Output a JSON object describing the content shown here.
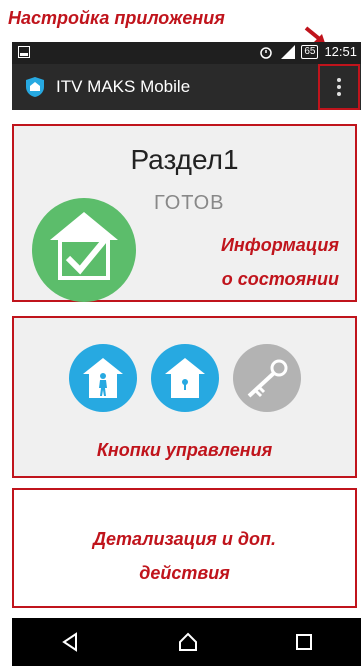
{
  "annotations": {
    "app_settings": "Настройка приложения",
    "status_info_line1": "Информация",
    "status_info_line2": "о состоянии",
    "control_buttons": "Кнопки управления",
    "details_line1": "Детализация и доп.",
    "details_line2": "действия"
  },
  "statusbar": {
    "battery": "65",
    "time": "12:51",
    "icons": [
      "picture-icon",
      "alarm-icon",
      "signal-icon",
      "battery-icon"
    ]
  },
  "appbar": {
    "title": "ITV MAKS Mobile",
    "icons": [
      "home-shield-icon",
      "overflow-menu-icon"
    ]
  },
  "section": {
    "name": "Раздел1",
    "state": "ГОТОВ"
  },
  "controls": {
    "icons": [
      "person-home-icon",
      "lock-home-icon",
      "key-icon"
    ]
  },
  "navbar": {
    "icons": [
      "back-icon",
      "home-icon",
      "recents-icon"
    ]
  },
  "colors": {
    "accent_red": "#c0141c",
    "ready_green": "#5cbd6b",
    "control_blue": "#27a9e1",
    "disabled_grey": "#b3b3b3"
  }
}
